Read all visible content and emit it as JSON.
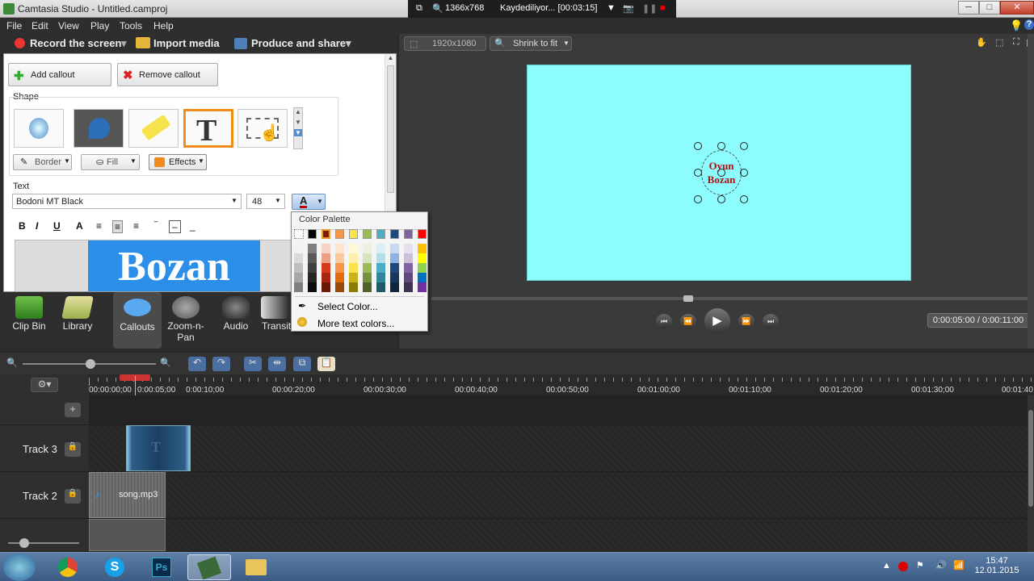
{
  "window": {
    "title": "Camtasia Studio - Untitled.camproj",
    "minimize": "─",
    "maximize": "□",
    "close": "✕"
  },
  "recorder": {
    "resolution": "1366x768",
    "status": "Kaydediliyor... [00:03:15]"
  },
  "menu": [
    "File",
    "Edit",
    "View",
    "Play",
    "Tools",
    "Help"
  ],
  "toolbar": {
    "record": "Record the screen",
    "import": "Import media",
    "produce": "Produce and share"
  },
  "callout_panel": {
    "add": "Add callout",
    "remove": "Remove callout",
    "shape_label": "Shape",
    "border": "Border",
    "fill": "Fill",
    "effects": "Effects",
    "text_label": "Text",
    "font": "Bodoni MT Black",
    "font_size": "48",
    "preview_text": "Bozan"
  },
  "palette": {
    "title": "Color Palette",
    "select_color": "Select Color...",
    "more_colors": "More text colors...",
    "top_colors": [
      "#000000",
      "#7f1f00",
      "#f79646",
      "#f9e34a",
      "#9bbb59",
      "#4bacc6",
      "#1f497d",
      "#8064a2",
      "#ff0000"
    ]
  },
  "preview": {
    "canvas_size": "1920x1080",
    "zoom": "Shrink to fit",
    "callout_line1": "Oyun",
    "callout_line2": "Bozan",
    "time": "0:00:05:00 / 0:00:11:00"
  },
  "tools": [
    {
      "label": "Clip Bin"
    },
    {
      "label": "Library"
    },
    {
      "label": "Callouts"
    },
    {
      "label": "Zoom-n-\nPan"
    },
    {
      "label": "Audio"
    },
    {
      "label": "Transit"
    }
  ],
  "timeline": {
    "playhead_label": "0:00:05;00",
    "ticks": [
      "00:00:00;00",
      "0:00:10;00",
      "00:00:20;00",
      "00:00:30;00",
      "00:00:40;00",
      "00:00:50;00",
      "00:01:00;00",
      "00:01:10;00",
      "00:01:20;00",
      "00:01:30;00",
      "00:01:40"
    ],
    "tracks": [
      {
        "name": "Track 3",
        "clip": "T"
      },
      {
        "name": "Track 2",
        "clip": "song.mp3"
      }
    ]
  },
  "taskbar": {
    "time": "15:47",
    "date": "12.01.2015"
  }
}
